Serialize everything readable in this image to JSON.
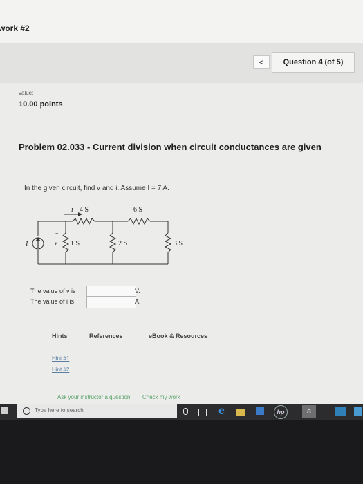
{
  "assignment": {
    "title": "work #2"
  },
  "nav": {
    "back_label": "<",
    "question_counter": "Question 4 (of 5)"
  },
  "points": {
    "label": "value:",
    "value": "10.00 points"
  },
  "problem": {
    "title": "Problem 02.033 - Current division when circuit conductances are given",
    "prompt": "In the given circuit, find v and i. Assume I = 7 A."
  },
  "circuit": {
    "source_label": "I",
    "current_label": "i",
    "voltage_label": "v",
    "plus": "+",
    "minus": "−",
    "g_series1": "4 S",
    "g_series2": "6 S",
    "g_shunt1": "1 S",
    "g_shunt2": "2 S",
    "g_shunt3": "3 S"
  },
  "answers": [
    {
      "label": "The value of v is",
      "value": "",
      "unit": "V."
    },
    {
      "label": "The value of i is",
      "value": "",
      "unit": "A."
    }
  ],
  "tabs": [
    "Hints",
    "References",
    "eBook & Resources"
  ],
  "hints": [
    "Hint #1",
    "Hint #2"
  ],
  "links": {
    "ask": "Ask your instructor a question",
    "check": "Check my work"
  },
  "taskbar": {
    "search_placeholder": "Type here to search",
    "amazon": "a",
    "hp": "hp"
  }
}
